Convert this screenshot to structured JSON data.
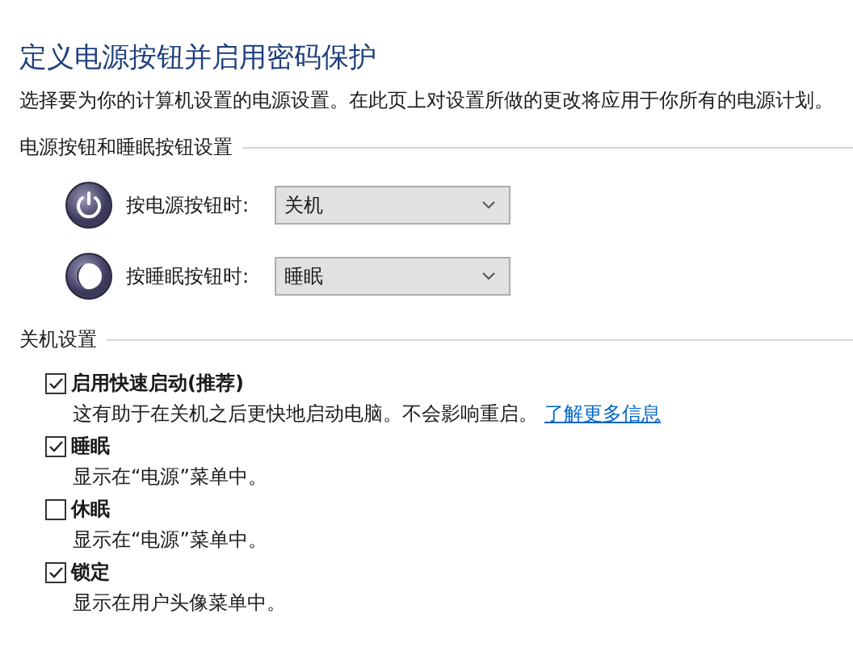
{
  "title": "定义电源按钮并启用密码保护",
  "description": "选择要为你的计算机设置的电源设置。在此页上对设置所做的更改将应用于你所有的电源计划。",
  "button_settings": {
    "heading": "电源按钮和睡眠按钮设置",
    "rows": [
      {
        "kind": "power",
        "label": "按电源按钮时:",
        "value": "关机"
      },
      {
        "kind": "sleep",
        "label": "按睡眠按钮时:",
        "value": "睡眠"
      }
    ]
  },
  "shutdown_settings": {
    "heading": "关机设置",
    "options": [
      {
        "label": "启用快速启动(推荐)",
        "checked": true,
        "note": "这有助于在关机之后更快地启动电脑。不会影响重启。",
        "link": "了解更多信息"
      },
      {
        "label": "睡眠",
        "checked": true,
        "note": "显示在“电源”菜单中。"
      },
      {
        "label": "休眠",
        "checked": false,
        "note": "显示在“电源”菜单中。"
      },
      {
        "label": "锁定",
        "checked": true,
        "note": "显示在用户头像菜单中。"
      }
    ]
  }
}
